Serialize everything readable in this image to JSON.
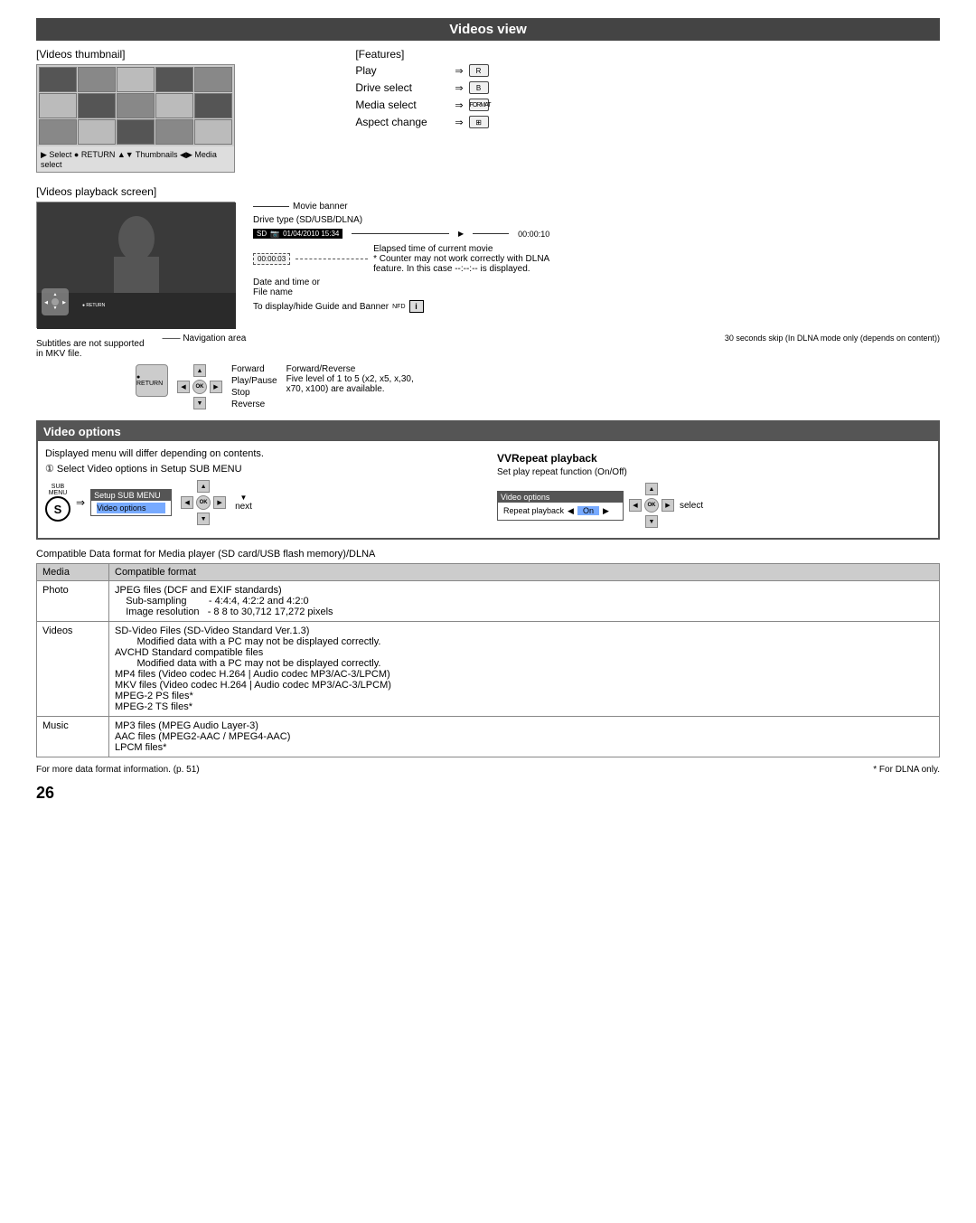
{
  "page": {
    "number": "26",
    "sections": {
      "videos_view": {
        "title": "Videos view",
        "thumbnail_label": "[Videos thumbnail]",
        "features_label": "[Features]",
        "features": [
          {
            "id": "play",
            "label": "Play",
            "button": "R"
          },
          {
            "id": "drive_select",
            "label": "Drive select",
            "button": "B"
          },
          {
            "id": "media_select",
            "label": "Media select",
            "button": "FORMAT"
          },
          {
            "id": "aspect_change",
            "label": "Aspect change",
            "button": "⊞"
          }
        ],
        "playback_screen_label": "[Videos playback screen]",
        "annotations": {
          "movie_banner": "Movie banner",
          "drive_type": "Drive type (SD/USB/DLNA)",
          "drive_display": "SD  01/04/2010 15:34",
          "elapsed_label": "Elapsed time of current movie",
          "elapsed_note": "* Counter may not work correctly with DLNA",
          "elapsed_note2": "feature. In this case --:--:-- is displayed.",
          "elapsed_value": "00:00:03",
          "time_value": "00:00:10",
          "datetime_label": "Date and time or",
          "filename_label": "File name",
          "nav_area": "Navigation area",
          "guide_label": "To display/hide Guide and Banner",
          "subtitles_note": "Subtitles are not supported\nin MKV file.",
          "skip_note": "30 seconds skip (In DLNA mode only (depends on content))",
          "forward": "Forward",
          "play_pause": "Play/Pause",
          "stop": "Stop",
          "reverse": "Reverse",
          "forward_reverse": "Forward/Reverse",
          "levels": "Five level of 1 to 5 (x2, x5, x,30,",
          "levels2": "x70, x100) are available."
        }
      },
      "video_options": {
        "title": "Video options",
        "desc": "Displayed menu will differ depending on contents.",
        "step": "① Select  Video options  in  Setup SUB MENU",
        "menu_header": "Setup SUB MENU",
        "menu_item": "Video options",
        "next_label": "next",
        "select_label": "select",
        "repeat_title": "VRepeat playback",
        "repeat_desc": "Set play repeat function (On/Off)",
        "repeat_menu_header": "Video options",
        "repeat_item": "Repeat playback",
        "repeat_value": "On"
      },
      "compat_table": {
        "title": "Compatible Data format for Media player (SD card/USB flash memory)/DLNA",
        "col_media": "Media",
        "col_format": "Compatible format",
        "rows": [
          {
            "media": "Photo",
            "format": "JPEG files (DCF and EXIF standards)\n    Sub-sampling       - 4:4:4, 4:2:2 and 4:2:0\n    Image resolution   - 8  8 to 30,712  17,272 pixels"
          },
          {
            "media": "Videos",
            "format": "SD-Video Files (SD-Video Standard Ver.1.3)\n        Modified data with a PC may not be displayed correctly.\nAVCHD Standard compatible files\n        Modified data with a PC may not be displayed correctly.\nMP4 files (Video codec H.264 | Audio codec MP3/AC-3/LPCM)\nMKV files (Video codec H.264 | Audio codec MP3/AC-3/LPCM)\nMPEG-2 PS files*\nMPEG-2 TS files*"
          },
          {
            "media": "Music",
            "format": "MP3 files (MPEG Audio Layer-3)\nAAC files (MPEG2-AAC / MPEG4-AAC)\nLPCM files*"
          }
        ]
      },
      "bottom_notes": {
        "left": "For more data format information. (p. 51)",
        "right": "* For DLNA only."
      }
    }
  }
}
